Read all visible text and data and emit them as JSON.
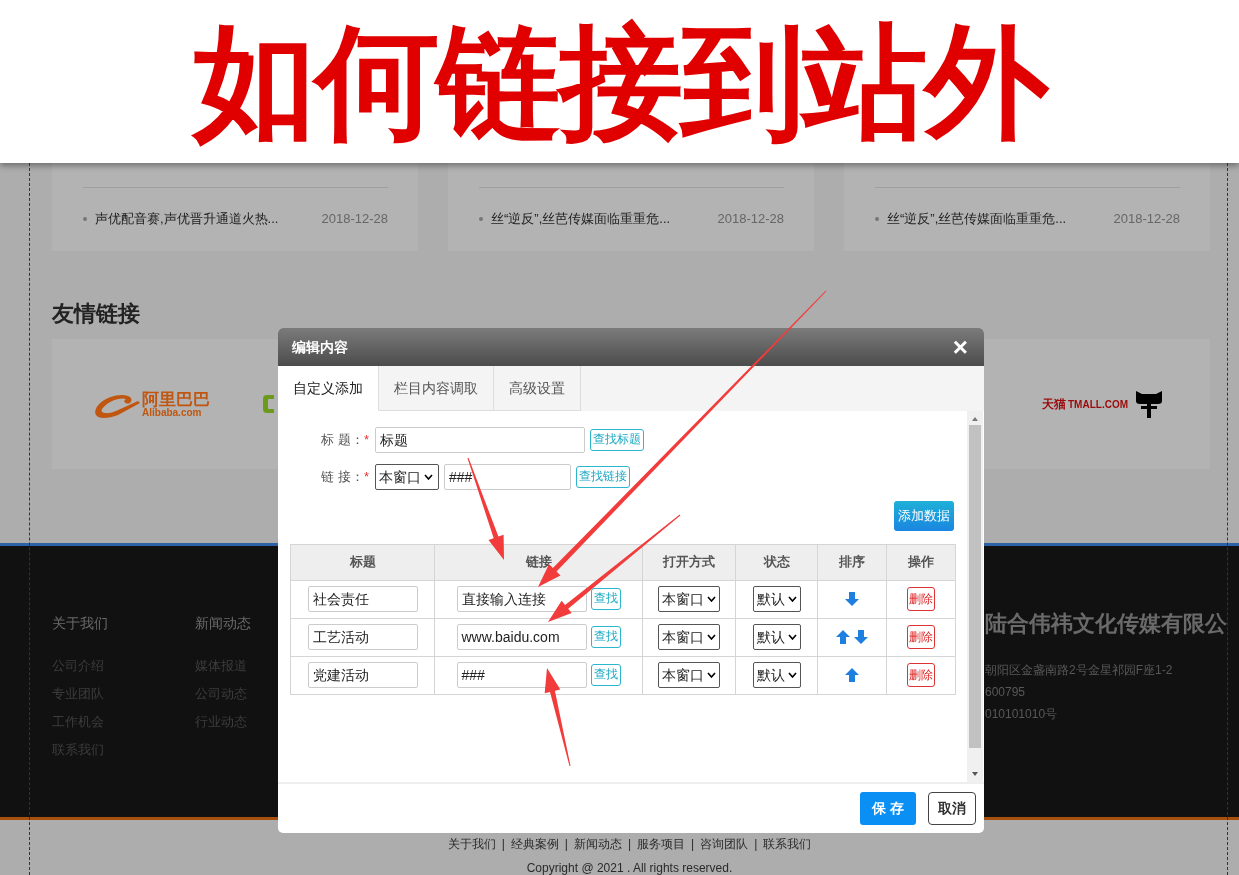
{
  "banner": {
    "title": "如何链接到站外"
  },
  "news_cards": [
    {
      "item": "声优配音赛,声优晋升通道火热...",
      "date": "2018-12-28"
    },
    {
      "item": "丝“逆反”,丝芭传媒面临重重危...",
      "date": "2018-12-28"
    },
    {
      "item": "丝“逆反”,丝芭传媒面临重重危...",
      "date": "2018-12-28"
    }
  ],
  "friend_links": {
    "heading": "友情链接",
    "logos": [
      {
        "kind": "alibaba",
        "name": "阿里巴巴",
        "sub": "Alibaba.com"
      },
      {
        "kind": "green_partial"
      },
      {
        "kind": "tmall",
        "name": "天猫",
        "sub": "TMALL.COM"
      }
    ]
  },
  "footer": {
    "columns": [
      {
        "heading": "关于我们",
        "links": [
          "公司介绍",
          "专业团队",
          "工作机会",
          "联系我们"
        ]
      },
      {
        "heading": "新闻动态",
        "links": [
          "媒体报道",
          "公司动态",
          "行业动态"
        ]
      }
    ],
    "company": {
      "name": "陆合伟祎文化传媒有限公",
      "lines": [
        "朝阳区金盏南路2号金星祁园F座1-2",
        "600795",
        "010101010号"
      ]
    }
  },
  "bottom": {
    "links": [
      "关于我们",
      "经典案例",
      "新闻动态",
      "服务项目",
      "咨询团队",
      "联系我们"
    ],
    "separator": "|",
    "copyright": "Copyright @ 2021 . All rights reserved."
  },
  "modal": {
    "title": "编辑内容",
    "close": "×",
    "tabs": [
      {
        "label": "自定义添加",
        "selected": true
      },
      {
        "label": "栏目内容调取",
        "selected": false
      },
      {
        "label": "高级设置",
        "selected": false
      }
    ],
    "form": [
      {
        "label": "标 题：",
        "required": "*",
        "value": "标题",
        "button": "查找标题"
      },
      {
        "label": "链 接：",
        "required": "*",
        "select": "本窗口",
        "value": "###",
        "button": "查找链接"
      }
    ],
    "add_button": "添加数据",
    "table": {
      "columns": [
        "标题",
        "链接",
        "打开方式",
        "状态",
        "排序",
        "操作"
      ],
      "rows": [
        {
          "title": "社会责任",
          "link": "直接输入连接",
          "find": "查找",
          "open": "本窗口",
          "status": "默认",
          "sort_up": false,
          "sort_down": true,
          "delete": "删除"
        },
        {
          "title": "工艺活动",
          "link": "www.baidu.com",
          "find": "查找",
          "open": "本窗口",
          "status": "默认",
          "sort_up": true,
          "sort_down": true,
          "delete": "删除"
        },
        {
          "title": "党建活动",
          "link": "###",
          "find": "查找",
          "open": "本窗口",
          "status": "默认",
          "sort_up": true,
          "sort_down": false,
          "delete": "删除"
        }
      ]
    },
    "save": "保 存",
    "cancel": "取消"
  }
}
